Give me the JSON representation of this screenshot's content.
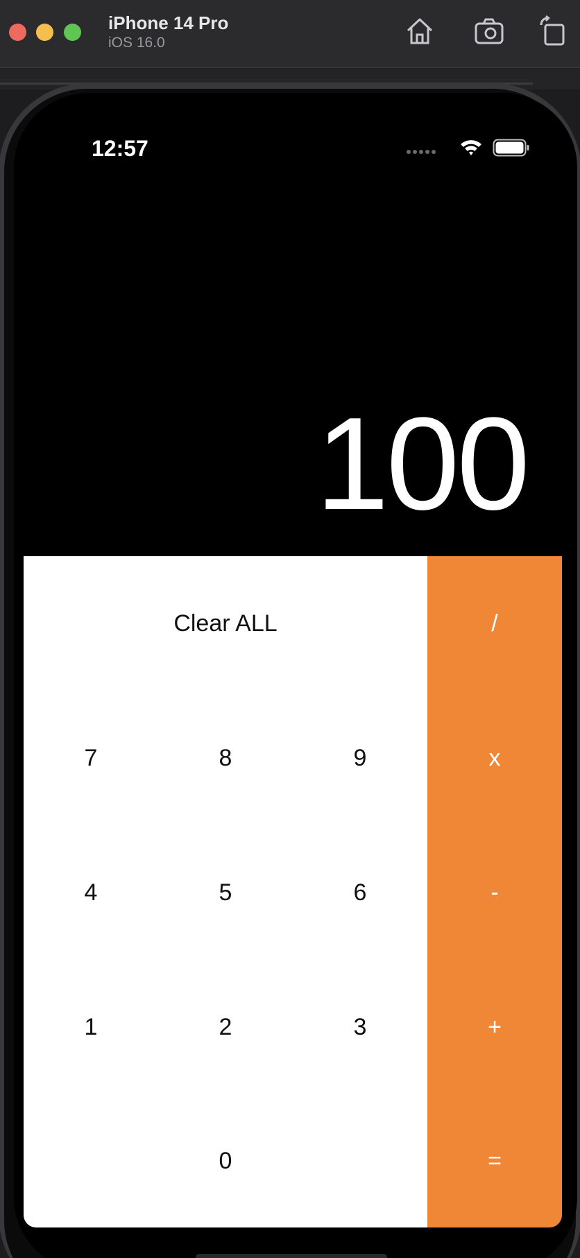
{
  "simulator": {
    "device_name": "iPhone 14 Pro",
    "os_version": "iOS 16.0",
    "toolbar_icons": [
      "home-icon",
      "screenshot-icon",
      "rotate-icon"
    ]
  },
  "status_bar": {
    "time": "12:57",
    "icons": [
      "signal-dots-icon",
      "wifi-icon",
      "battery-icon"
    ]
  },
  "display": {
    "value": "100"
  },
  "keys": {
    "clear": "Clear ALL",
    "divide": "/",
    "seven": "7",
    "eight": "8",
    "nine": "9",
    "multiply": "x",
    "four": "4",
    "five": "5",
    "six": "6",
    "minus": "-",
    "one": "1",
    "two": "2",
    "three": "3",
    "plus": "+",
    "zero": "0",
    "equals": "="
  },
  "colors": {
    "operator": "#ef8736",
    "number_key": "#ffffff",
    "screen": "#000000"
  }
}
